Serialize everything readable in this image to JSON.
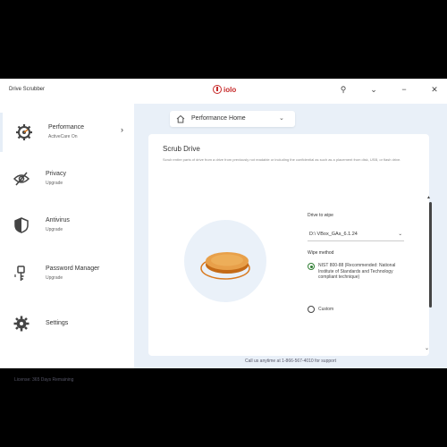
{
  "app": {
    "title": "Drive Scrubber",
    "brand": "iolo"
  },
  "titlebar": {
    "pin": "⚲",
    "menu": "⌄",
    "minimize": "−",
    "close": "✕"
  },
  "sidebar": {
    "items": [
      {
        "label": "Performance",
        "sub": "ActiveCare On",
        "icon": "gear-speed-icon"
      },
      {
        "label": "Privacy",
        "sub": "Upgrade",
        "icon": "eye-slash-icon"
      },
      {
        "label": "Antivirus",
        "sub": "Upgrade",
        "icon": "shield-icon"
      },
      {
        "label": "Password Manager",
        "sub": "Upgrade",
        "icon": "key-icon"
      },
      {
        "label": "Settings",
        "sub": "",
        "icon": "gear-icon"
      }
    ],
    "license": "License: 365 Days Remaining"
  },
  "main": {
    "home_select": "Performance Home",
    "card_title": "Scrub Drive",
    "card_desc": "Scrub entire parts of drive from a drive from previously not readable or including the confidential as such as a placement from disk, USB, or flash drive.",
    "drive_label": "Drive to wipe",
    "drive_value": "D:\\ VBox_GAs_6.1.24",
    "wipe_label": "Wipe method",
    "wipe_option_1": "NIST 800-88 (Recommended: National Institute of Standards and Technology compliant technique)",
    "wipe_option_2": "Custom",
    "support": "Call us anytime at 1-866-567-4010 for support"
  },
  "colors": {
    "accent": "#d97a20",
    "brand": "#c62828",
    "main_bg": "#e9f0f8"
  }
}
